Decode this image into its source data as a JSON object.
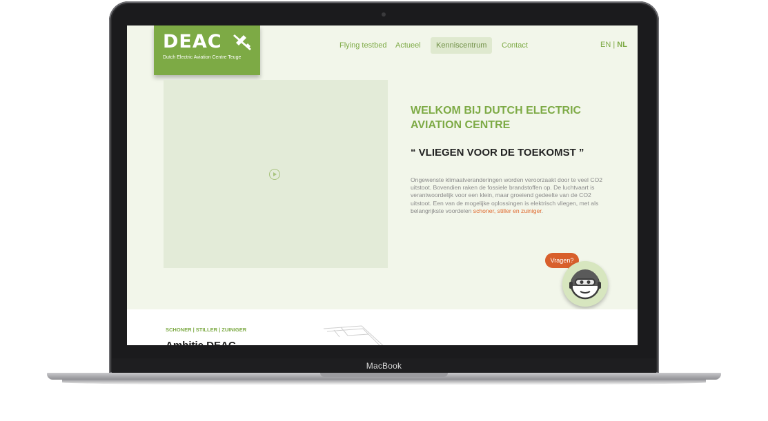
{
  "device": {
    "brand": "MacBook"
  },
  "logo": {
    "word": "DEAC",
    "subtitle": "Dutch Electric Aviation Centre Teuge"
  },
  "nav": {
    "items": [
      {
        "label": "Flying testbed",
        "active": false
      },
      {
        "label": "Actueel",
        "active": false
      },
      {
        "label": "Kenniscentrum",
        "active": true
      },
      {
        "label": "Contact",
        "active": false
      }
    ]
  },
  "language": {
    "en": "EN",
    "separator": "|",
    "nl": "NL",
    "selected": "NL"
  },
  "hero": {
    "welcome": "WELKOM BIJ DUTCH ELECTRIC AVIATION CENTRE",
    "slogan": "“ VLIEGEN VOOR DE TOEKOMST ”",
    "intro_text": "Ongewenste klimaatveranderingen worden veroorzaakt door te veel CO2 uitstoot. Bovendien raken de fossiele brandstoffen op. De luchtvaart is verantwoordelijk voor een klein, maar groeiend gedeelte van de CO2 uitstoot. Een van de mogelijke oplossingen is elektrisch vliegen, met als belangrijkste voordelen ",
    "intro_highlight": "schoner, stiller en zuiniger",
    "intro_end": "."
  },
  "chat": {
    "bubble": "Vragen?"
  },
  "section": {
    "tagline": "SCHONER | STILLER | ZUINIGER",
    "heading": "Ambitie DEAC"
  },
  "colors": {
    "accent": "#7daa45",
    "highlight": "#e06a30",
    "bubble": "#d85f2c",
    "background": "#f2f6ea"
  }
}
